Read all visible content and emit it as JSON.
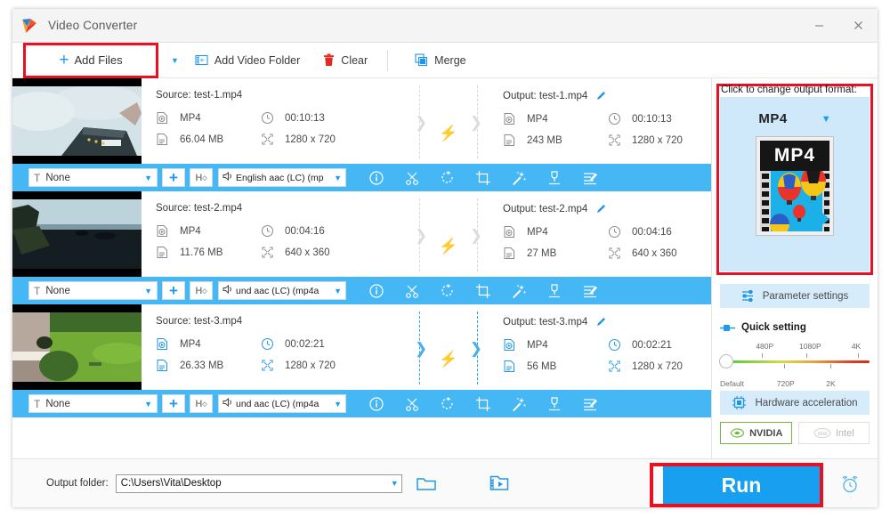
{
  "window": {
    "title": "Video Converter",
    "minimize_label": "–",
    "close_label": "✕"
  },
  "toolbar": {
    "add_files_label": "Add Files",
    "add_files_plus": "+",
    "dropdown_caret": "▼",
    "add_video_folder_label": "Add Video Folder",
    "clear_label": "Clear",
    "merge_label": "Merge"
  },
  "files": [
    {
      "source_label": "Source: test-1.mp4",
      "output_label": "Output: test-1.mp4",
      "src_format": "MP4",
      "src_duration": "00:10:13",
      "src_size": "66.04 MB",
      "src_resolution": "1280 x 720",
      "out_format": "MP4",
      "out_duration": "00:10:13",
      "out_size": "243 MB",
      "out_resolution": "1280 x 720",
      "subtitle": "None",
      "audio": "English aac (LC) (mp",
      "selected": false
    },
    {
      "source_label": "Source: test-2.mp4",
      "output_label": "Output: test-2.mp4",
      "src_format": "MP4",
      "src_duration": "00:04:16",
      "src_size": "11.76 MB",
      "src_resolution": "640 x 360",
      "out_format": "MP4",
      "out_duration": "00:04:16",
      "out_size": "27 MB",
      "out_resolution": "640 x 360",
      "subtitle": "None",
      "audio": "und aac (LC) (mp4a",
      "selected": false
    },
    {
      "source_label": "Source: test-3.mp4",
      "output_label": "Output: test-3.mp4",
      "src_format": "MP4",
      "src_duration": "00:02:21",
      "src_size": "26.33 MB",
      "src_resolution": "1280 x 720",
      "out_format": "MP4",
      "out_duration": "00:02:21",
      "out_size": "56 MB",
      "out_resolution": "1280 x 720",
      "subtitle": "None",
      "audio": "und aac (LC) (mp4a",
      "selected": true
    }
  ],
  "row_bar": {
    "subtitle_prefix_icon": "T",
    "add_subtitle_label": "+",
    "hdr_label": "H",
    "tools": [
      "info-icon",
      "cut-icon",
      "rotate-icon",
      "crop-icon",
      "effect-icon",
      "watermark-icon",
      "subtitle-edit-icon"
    ]
  },
  "right_panel": {
    "format_hint": "Click to change output format:",
    "format_name": "MP4",
    "format_caret": "▼",
    "format_badge": "MP4",
    "parameter_settings_label": "Parameter settings",
    "quick_setting_label": "Quick setting",
    "quality_top_labels": [
      "480P",
      "1080P",
      "4K"
    ],
    "quality_bottom_labels": [
      "Default",
      "720P",
      "2K"
    ],
    "hardware_acceleration_label": "Hardware acceleration",
    "gpu_nvidia_label": "NVIDIA",
    "gpu_intel_label": "Intel"
  },
  "bottom": {
    "output_folder_label": "Output folder:",
    "output_folder_value": "C:\\Users\\Vita\\Desktop",
    "output_folder_caret": "▼",
    "run_label": "Run"
  },
  "colors": {
    "accent_blue": "#189ff0",
    "bar_blue": "#45b7f5",
    "highlight_red": "#e81123",
    "bolt_orange": "#ff7a18"
  }
}
